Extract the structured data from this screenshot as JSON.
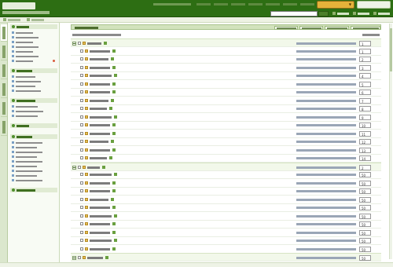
{
  "brand": {
    "name": "",
    "tagline": "",
    "accent": "#2d6e13"
  },
  "header": {
    "admin_info": "",
    "links": [
      "",
      "",
      "",
      "",
      "",
      "",
      "",
      ""
    ],
    "quick_select": "",
    "close_button": "",
    "search_value": "",
    "search_button": "",
    "actions": [
      "",
      "",
      ""
    ]
  },
  "subbar": {
    "items": [
      {
        "label": "",
        "icon": "home-icon"
      },
      {
        "label": "",
        "icon": "grid-icon"
      }
    ]
  },
  "tabs": [
    "",
    "",
    "",
    "",
    "",
    ""
  ],
  "sidebar": {
    "groups": [
      {
        "title": "",
        "items": [
          {
            "label": ""
          },
          {
            "label": ""
          },
          {
            "label": ""
          },
          {
            "label": ""
          },
          {
            "label": ""
          },
          {
            "label": ""
          },
          {
            "label": "",
            "badge": true
          }
        ]
      },
      {
        "title": "",
        "items": [
          {
            "label": ""
          },
          {
            "label": ""
          },
          {
            "label": ""
          },
          {
            "label": ""
          }
        ]
      },
      {
        "title": "",
        "items": [
          {
            "label": ""
          },
          {
            "label": ""
          },
          {
            "label": ""
          }
        ]
      },
      {
        "title": "",
        "items": []
      },
      {
        "title": "",
        "items": [
          {
            "label": ""
          },
          {
            "label": ""
          },
          {
            "label": ""
          },
          {
            "label": ""
          },
          {
            "label": ""
          },
          {
            "label": ""
          },
          {
            "label": ""
          },
          {
            "label": ""
          },
          {
            "label": ""
          }
        ]
      },
      {
        "title": "",
        "items": []
      }
    ]
  },
  "panel": {
    "title": "",
    "buttons": [
      "",
      "",
      "",
      ""
    ],
    "hint": "",
    "hint_right": ""
  },
  "tree": [
    {
      "level": 0,
      "name": "",
      "order": "1",
      "ops": ""
    },
    {
      "level": 1,
      "name": "",
      "order": "1",
      "ops": ""
    },
    {
      "level": 1,
      "name": "",
      "order": "2",
      "ops": ""
    },
    {
      "level": 1,
      "name": "",
      "order": "3",
      "ops": ""
    },
    {
      "level": 1,
      "name": "",
      "order": "4",
      "ops": ""
    },
    {
      "level": 1,
      "name": "",
      "order": "5",
      "ops": ""
    },
    {
      "level": 1,
      "name": "",
      "order": "6",
      "ops": ""
    },
    {
      "level": 1,
      "name": "",
      "order": "7",
      "ops": ""
    },
    {
      "level": 1,
      "name": "",
      "order": "8",
      "ops": ""
    },
    {
      "level": 1,
      "name": "",
      "order": "9",
      "ops": ""
    },
    {
      "level": 1,
      "name": "",
      "order": "10",
      "ops": ""
    },
    {
      "level": 1,
      "name": "",
      "order": "11",
      "ops": ""
    },
    {
      "level": 1,
      "name": "",
      "order": "12",
      "ops": ""
    },
    {
      "level": 1,
      "name": "",
      "order": "13",
      "ops": ""
    },
    {
      "level": 1,
      "name": "",
      "order": "14",
      "ops": ""
    },
    {
      "level": 0,
      "name": "",
      "order": "2",
      "ops": ""
    },
    {
      "level": 1,
      "name": "",
      "order": "50",
      "ops": ""
    },
    {
      "level": 1,
      "name": "",
      "order": "50",
      "ops": ""
    },
    {
      "level": 1,
      "name": "",
      "order": "50",
      "ops": ""
    },
    {
      "level": 1,
      "name": "",
      "order": "50",
      "ops": ""
    },
    {
      "level": 1,
      "name": "",
      "order": "50",
      "ops": ""
    },
    {
      "level": 1,
      "name": "",
      "order": "50",
      "ops": ""
    },
    {
      "level": 1,
      "name": "",
      "order": "50",
      "ops": ""
    },
    {
      "level": 1,
      "name": "",
      "order": "50",
      "ops": ""
    },
    {
      "level": 1,
      "name": "",
      "order": "50",
      "ops": ""
    },
    {
      "level": 1,
      "name": "",
      "order": "50",
      "ops": ""
    },
    {
      "level": 0,
      "name": "",
      "order": "50",
      "ops": ""
    }
  ]
}
